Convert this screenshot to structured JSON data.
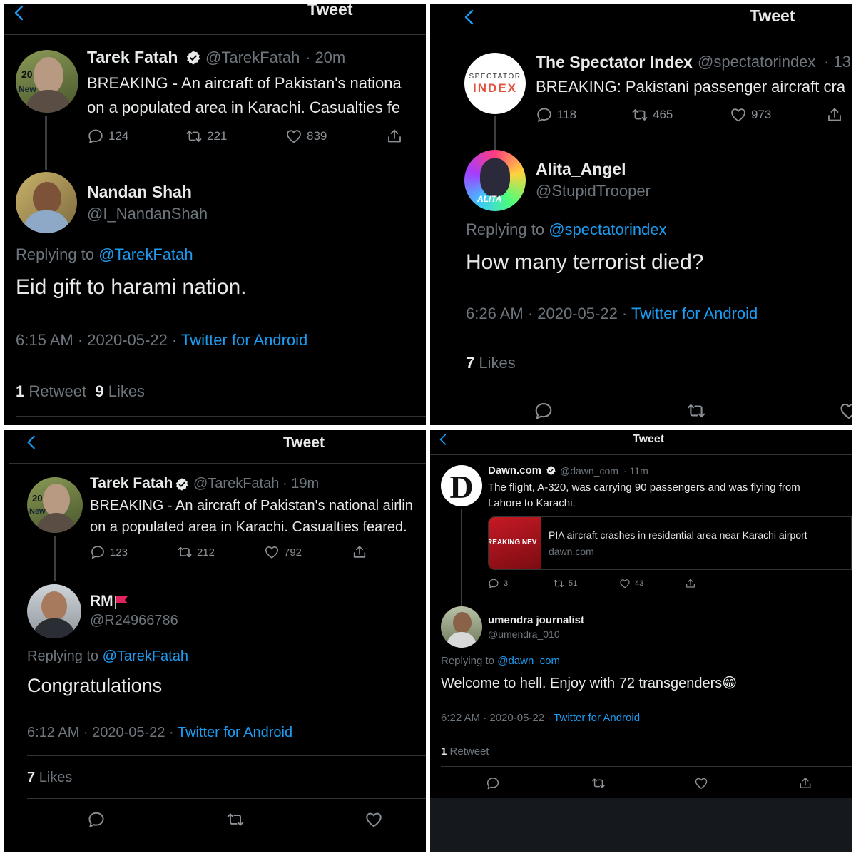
{
  "p1": {
    "title": "Tweet",
    "orig": {
      "name": "Tarek Fatah",
      "handle": "@TarekFatah",
      "time": "· 20m",
      "line1": "BREAKING - An aircraft of Pakistan's nationa",
      "line2": "on a populated area in Karachi. Casualties fe",
      "avatar_text_1": "20",
      "avatar_text_2": "New",
      "replies": "124",
      "retweets": "221",
      "likes": "839"
    },
    "reply": {
      "name": "Nandan Shah",
      "handle": "@I_NandanShah",
      "replying_prefix": "Replying to",
      "replying_to": "@TarekFatah",
      "text": "Eid gift to harami nation.",
      "timestamp": "6:15 AM · 2020-05-22 ·",
      "source": "Twitter for Android",
      "retweet_count": "1",
      "retweet_label": "Retweet",
      "like_count": "9",
      "like_label": "Likes"
    }
  },
  "p2": {
    "title": "Tweet",
    "orig": {
      "name": "The Spectator Index",
      "handle": "@spectatorindex",
      "time": "· 13",
      "text": "BREAKING: Pakistani passenger aircraft cra",
      "logo_top": "SPECTATOR",
      "logo_bottom": "INDEX",
      "replies": "118",
      "retweets": "465",
      "likes": "973"
    },
    "reply": {
      "name": "Alita_Angel",
      "handle": "@StupidTrooper",
      "avatar_text": "ALITA",
      "replying_prefix": "Replying to",
      "replying_to": "@spectatorindex",
      "text": "How many terrorist died?",
      "timestamp": "6:26 AM · 2020-05-22 ·",
      "source": "Twitter for Android",
      "like_count": "7",
      "like_label": "Likes"
    }
  },
  "p3": {
    "title": "Tweet",
    "orig": {
      "name": "Tarek Fatah",
      "handle": "@TarekFatah",
      "time": "· 19m",
      "line1": "BREAKING - An aircraft of Pakistan's national airlin",
      "line2": "on a populated area in Karachi. Casualties feared.",
      "avatar_text_1": "20",
      "avatar_text_2": "New",
      "replies": "123",
      "retweets": "212",
      "likes": "792"
    },
    "reply": {
      "name": "RM",
      "handle": "@R24966786",
      "replying_prefix": "Replying to",
      "replying_to": "@TarekFatah",
      "text": "Congratulations",
      "timestamp": "6:12 AM · 2020-05-22 ·",
      "source": "Twitter for Android",
      "like_count": "7",
      "like_label": "Likes"
    }
  },
  "p4": {
    "title": "Tweet",
    "orig": {
      "name": "Dawn.com",
      "handle": "@dawn_com",
      "time": "· 11m",
      "line1": "The flight, A-320, was carrying 90 passengers and was flying from",
      "line2": "Lahore to Karachi.",
      "logo_letter": "D",
      "card_image_text": "REAKING NEV",
      "card_title": "PIA aircraft crashes in residential area near Karachi airport",
      "card_domain": "dawn.com",
      "replies": "3",
      "retweets": "51",
      "likes": "43"
    },
    "reply": {
      "name": "umendra journalist",
      "handle": "@umendra_010",
      "replying_prefix": "Replying to",
      "replying_to": "@dawn_com",
      "text": "Welcome to hell. Enjoy with 72 transgenders😁",
      "timestamp": "6:22 AM · 2020-05-22 ·",
      "source": "Twitter for Android",
      "retweet_count": "1",
      "retweet_label": "Retweet"
    }
  },
  "colors": {
    "background": "#000000",
    "accent": "#1d9bf0",
    "muted": "#6e767d",
    "text": "#e7e9ea",
    "divider": "#2f3336",
    "flag": "#e0245e"
  },
  "icons": [
    "back-chevron-icon",
    "verified-badge-icon",
    "reply-icon",
    "retweet-icon",
    "like-icon",
    "share-icon",
    "red-flag-icon"
  ]
}
